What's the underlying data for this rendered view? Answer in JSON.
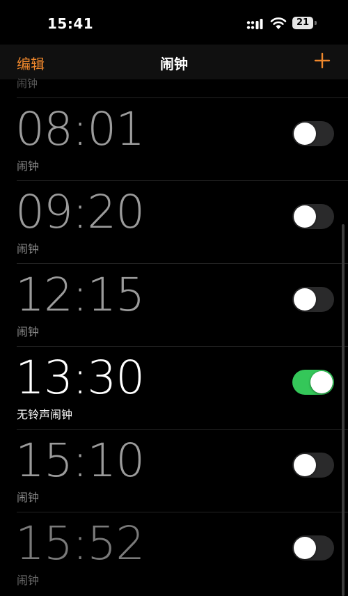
{
  "status": {
    "time": "15:41",
    "battery": "21"
  },
  "nav": {
    "edit_label": "编辑",
    "title": "闹钟"
  },
  "peek_label": "闹钟",
  "alarms": [
    {
      "time": "08:01",
      "label": "闹钟",
      "enabled": false
    },
    {
      "time": "09:20",
      "label": "闹钟",
      "enabled": false
    },
    {
      "time": "12:15",
      "label": "闹钟",
      "enabled": false
    },
    {
      "time": "13:30",
      "label": "无铃声闹钟",
      "enabled": true
    },
    {
      "time": "15:10",
      "label": "闹钟",
      "enabled": false
    },
    {
      "time": "15:52",
      "label": "闹钟",
      "enabled": false
    }
  ],
  "colors": {
    "accent": "#f0882c",
    "toggle_on": "#34c759",
    "toggle_off": "#2a2a2b"
  }
}
